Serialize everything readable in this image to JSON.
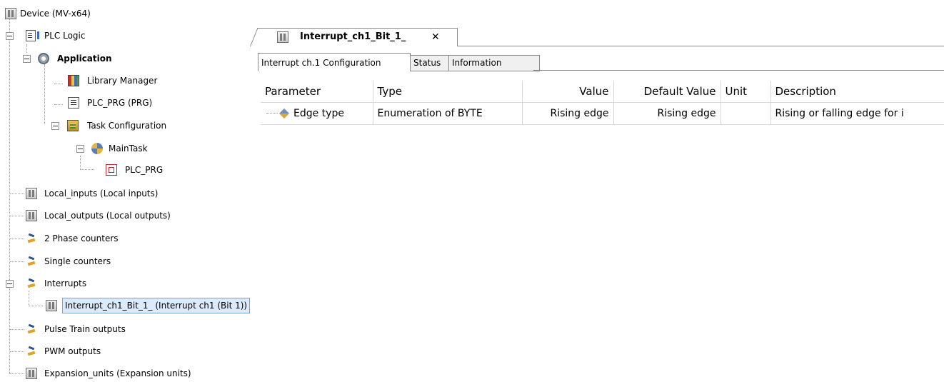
{
  "tree": {
    "nodes": [
      {
        "label": "Device (MV-x64)",
        "icon": "device-icon"
      },
      {
        "label": "PLC Logic",
        "icon": "plc-logic-icon"
      },
      {
        "label": "Application",
        "icon": "application-gear-icon"
      },
      {
        "label": "Library Manager",
        "icon": "library-books-icon"
      },
      {
        "label": "PLC_PRG (PRG)",
        "icon": "program-document-icon"
      },
      {
        "label": "Task Configuration",
        "icon": "task-configuration-icon"
      },
      {
        "label": "MainTask",
        "icon": "task-icon"
      },
      {
        "label": "PLC_PRG",
        "icon": "program-call-icon"
      },
      {
        "label": "Local_inputs (Local inputs)",
        "icon": "device-icon"
      },
      {
        "label": "Local_outputs (Local outputs)",
        "icon": "device-icon"
      },
      {
        "label": "2 Phase counters",
        "icon": "counter-folder-icon"
      },
      {
        "label": "Single counters",
        "icon": "counter-folder-icon"
      },
      {
        "label": "Interrupts",
        "icon": "counter-folder-icon"
      },
      {
        "label": "Interrupt_ch1_Bit_1_ (Interrupt ch1 (Bit 1))",
        "icon": "device-icon"
      },
      {
        "label": "Pulse Train outputs",
        "icon": "counter-folder-icon"
      },
      {
        "label": "PWM outputs",
        "icon": "counter-folder-icon"
      },
      {
        "label": "Expansion_units (Expansion units)",
        "icon": "device-icon"
      }
    ]
  },
  "editor": {
    "document_tab": {
      "label": "Interrupt_ch1_Bit_1_",
      "close_glyph": "✕"
    },
    "sub_tabs": [
      "Interrupt ch.1 Configuration",
      "Status",
      "Information"
    ],
    "table": {
      "headers": [
        "Parameter",
        "Type",
        "Value",
        "Default Value",
        "Unit",
        "Description"
      ],
      "rows": [
        {
          "parameter": "Edge type",
          "type": "Enumeration of BYTE",
          "value": "Rising edge",
          "default_value": "Rising edge",
          "unit": "",
          "description": "Rising or falling edge for i"
        }
      ]
    }
  },
  "colors": {
    "selection_bg": "#dcebfc",
    "selection_border": "#7da2ce"
  }
}
